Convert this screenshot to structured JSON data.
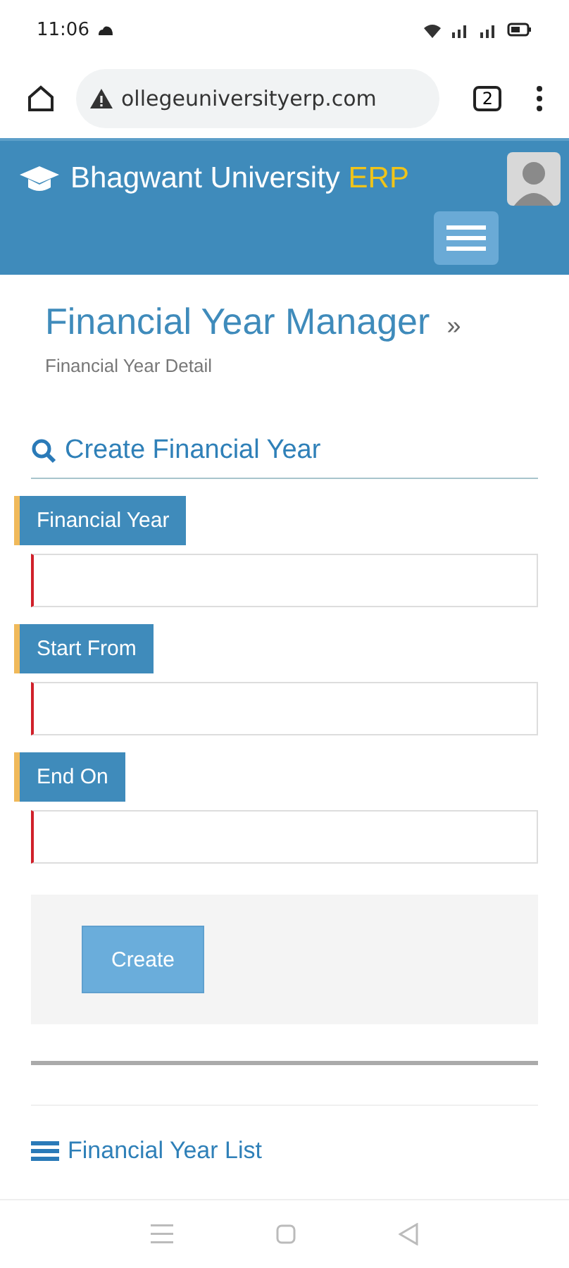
{
  "status_bar": {
    "time": "11:06"
  },
  "browser": {
    "url": "ollegeuniversityerp.com",
    "tab_count": "2"
  },
  "header": {
    "brand": "Bhagwant University",
    "brand_suffix": "ERP"
  },
  "page": {
    "title": "Financial Year Manager",
    "title_sep": "»",
    "subtitle": "Financial Year Detail"
  },
  "form": {
    "heading": "Create Financial Year",
    "fields": [
      {
        "label": "Financial Year"
      },
      {
        "label": "Start From"
      },
      {
        "label": "End On"
      }
    ],
    "button": "Create"
  },
  "list": {
    "heading": "Financial Year List"
  }
}
